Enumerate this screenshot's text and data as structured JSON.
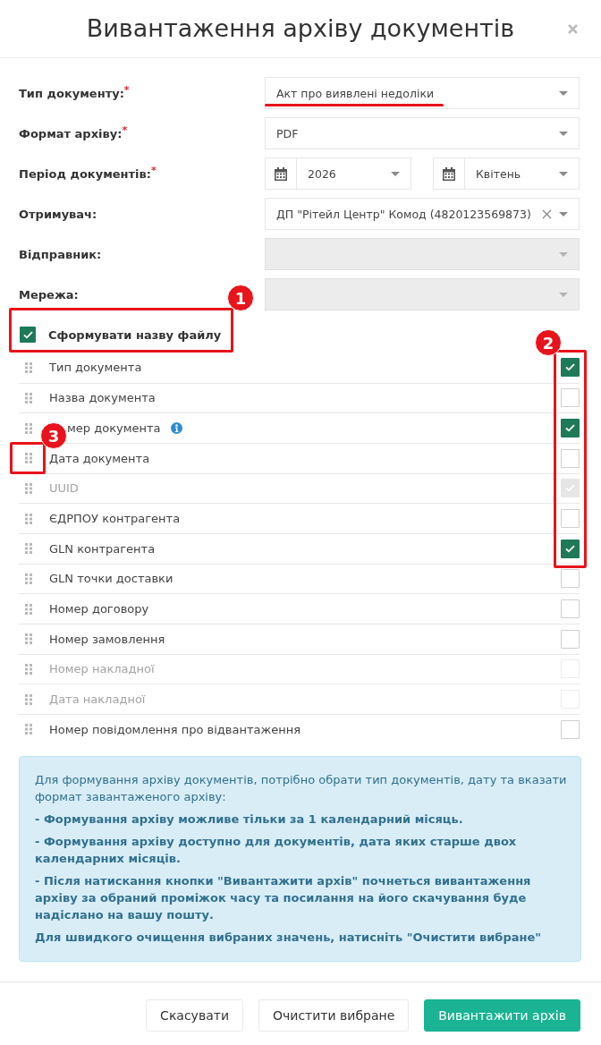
{
  "dialog": {
    "title": "Вивантаження архіву документів"
  },
  "form": {
    "fields": [
      {
        "kind": "select",
        "label": "Тип документу:$^{*}$",
        "value": "Акт про виявлені недоліки",
        "disabled": false,
        "clearable": false
      },
      {
        "kind": "select",
        "label": "Формат архіву:$^{*}$",
        "value": "PDF",
        "disabled": false,
        "clearable": false
      },
      {
        "kind": "period",
        "label": "Період документів:$^{*}$",
        "parts": [
          {
            "value": "2026"
          },
          {
            "value": "Квітень"
          }
        ]
      },
      {
        "kind": "select",
        "label": "Отримувач:",
        "value": "ДП \"Рітейл Центр\" Комод (4820123569873)",
        "disabled": false,
        "clearable": true
      },
      {
        "kind": "select",
        "label": "Відправник:",
        "disabled": true,
        "clearable": false
      },
      {
        "kind": "select",
        "label": "Мережа:",
        "disabled": true,
        "clearable": false
      }
    ]
  },
  "filename": {
    "label": "Сформувати назву файлу",
    "checked": true
  },
  "name_parts": [
    {
      "label": "Тип документа",
      "checked": true,
      "disabled": false,
      "info": false
    },
    {
      "label": "Назва документа",
      "checked": false,
      "disabled": false,
      "info": false
    },
    {
      "label": "мер документа",
      "checked": true,
      "disabled": false,
      "info": true
    },
    {
      "label": "Дата документа",
      "checked": false,
      "disabled": false,
      "info": false
    },
    {
      "label": "UUID",
      "checked": true,
      "disabled": true,
      "info": false
    },
    {
      "label": "ЄДРПОУ контрагента",
      "checked": false,
      "disabled": false,
      "info": false
    },
    {
      "label": "GLN контрагента",
      "checked": true,
      "disabled": false,
      "info": false
    },
    {
      "label": "GLN точки доставки",
      "checked": false,
      "disabled": false,
      "info": false
    },
    {
      "label": "Номер договору",
      "checked": false,
      "disabled": false,
      "info": false
    },
    {
      "label": "Номер замовлення",
      "checked": false,
      "disabled": false,
      "info": false
    },
    {
      "label": "Номер накладної",
      "checked": false,
      "disabled": true,
      "info": false
    },
    {
      "label": "Дата накладної",
      "checked": false,
      "disabled": true,
      "info": false
    },
    {
      "label": "Номер повідомлення про відвантаження",
      "checked": false,
      "disabled": false,
      "info": false
    }
  ],
  "notice": {
    "paragraphs": [
      {
        "text": "Для формування архіву документів, потрібно обрати тип документів, дату та вказати формат завантаженого архіву:",
        "bold": false
      },
      {
        "text": "- Формування архіву можливе тільки за 1 календарний місяць.",
        "bold": true
      },
      {
        "text": "- Формування архіву доступно для документів, дата яких старше двох календарних місяців.",
        "bold": true
      },
      {
        "text": "- Після натискання кнопки \"Вивантажити архів\" почнеться вивантаження архіву за обраний проміжок часу та посилання на його скачування буде надіслано на вашу пошту.",
        "bold": true
      },
      {
        "text": "Для швидкого очищення вибраних значень, натисніть \"Очистити вибране\"",
        "bold": true
      }
    ]
  },
  "buttons": [
    {
      "label": "Скасувати",
      "kind": "default"
    },
    {
      "label": "Очистити вибране",
      "kind": "default"
    },
    {
      "label": "Вивантажити архів",
      "kind": "primary"
    }
  ],
  "annotations": [
    {
      "kind": "underline"
    },
    {
      "kind": "frame",
      "number": "1"
    },
    {
      "kind": "frame",
      "number": "2"
    },
    {
      "kind": "frame",
      "number": "3"
    }
  ]
}
